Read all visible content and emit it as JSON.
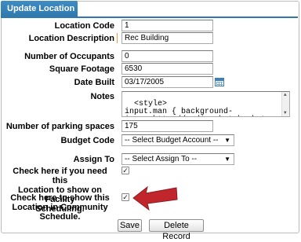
{
  "window": {
    "title": "Update Location"
  },
  "fields": {
    "location_code": {
      "label": "Location Code",
      "value": "1"
    },
    "location_description": {
      "label": "Location Description",
      "value": "Rec Building"
    },
    "number_of_occupants": {
      "label": "Number of Occupants",
      "value": "0"
    },
    "square_footage": {
      "label": "Square Footage",
      "value": "6530"
    },
    "date_built": {
      "label": "Date Built",
      "value": "03/17/2005"
    },
    "notes": {
      "label": "Notes",
      "value": "<style>\ninput.man { background-\nimage:http://media.photobucket.com/user/ils"
    },
    "parking_spaces": {
      "label": "Number of parking spaces",
      "value": "175"
    },
    "budget_code": {
      "label": "Budget Code",
      "selected": "-- Select Budget Account --"
    },
    "assign_to": {
      "label": "Assign To",
      "selected": "-- Select Assign To --"
    },
    "facility_scheduling": {
      "label_lines": [
        "Check here if you need this",
        "Location to show on Facility",
        "Scheduling."
      ],
      "checked": true
    },
    "community_schedule": {
      "label_lines": [
        "Check here to show this",
        "Location in Community",
        "Schedule."
      ],
      "checked": true
    }
  },
  "buttons": {
    "save": "Save",
    "delete": "Delete Record"
  },
  "icons": {
    "calendar": "calendar-icon",
    "dropdown": "chevron-down-icon",
    "check": "checkmark-icon"
  },
  "colors": {
    "title_bar": "#2f79ad",
    "required_marker": "#f29b2f",
    "annotation_arrow": "#c0262b"
  }
}
